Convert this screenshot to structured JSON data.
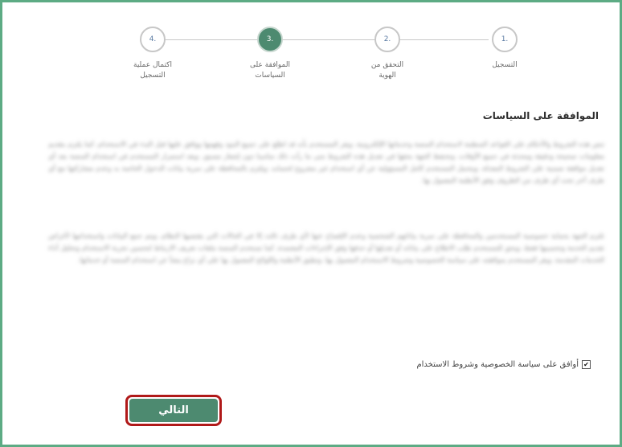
{
  "steps": [
    {
      "number": "1.",
      "label": "التسجيل"
    },
    {
      "number": "2.",
      "label": "التحقق من الهوية"
    },
    {
      "number": "3.",
      "label": "الموافقة على السياسات"
    },
    {
      "number": "4.",
      "label": "اكتمال عملية التسجيل"
    }
  ],
  "active_step": 3,
  "section_title": "الموافقة على السياسات",
  "policy_paragraphs": [
    "تنص هذه الشروط والأحكام على القواعد المنظمة لاستخدام المنصة وخدماتها الإلكترونية، ويقر المستخدم بأنه قد اطلع على جميع البنود وفهمها ووافق عليها قبل البدء في الاستخدام، كما يلتزم بتقديم معلومات صحيحة ودقيقة ومحدثة في جميع الأوقات، وتحتفظ الجهة بحقها في تعديل هذه الشروط متى ما رأت ذلك مناسبا دون إشعار مسبق، ويعد استمرار المستخدم في استخدام المنصة بعد أي تعديل موافقة ضمنية على الشروط المعدلة، ويتحمل المستخدم كامل المسؤولية عن أي استخدام غير مشروع لحسابه، ويلتزم بالمحافظة على سرية بيانات الدخول الخاصة به وعدم مشاركتها مع أي طرف آخر تحت أي ظرف من الظروف وفق الأنظمة المعمول بها.",
    "تلتزم الجهة بحماية خصوصية المستخدمين والمحافظة على سرية بياناتهم الشخصية وعدم الإفصاح عنها لأي طرف ثالث إلا في الحالات التي يقتضيها النظام، ويتم جمع البيانات واستخدامها لأغراض تقديم الخدمة وتحسينها فقط، ويحق للمستخدم طلب الاطلاع على بياناته أو تعديلها أو حذفها وفق الإجراءات المعتمدة، كما تستخدم المنصة ملفات تعريف الارتباط لتحسين تجربة الاستخدام وتحليل أداء الخدمات المقدمة، ويقر المستخدم بموافقته على سياسة الخصوصية وشروط الاستخدام المعمول بها، وتطبق الأنظمة واللوائح المعمول بها على أي نزاع ينشأ عن استخدام المنصة أو خدماتها."
  ],
  "consent": {
    "checked": true,
    "label": "أوافق على سياسة الخصوصية وشروط الاستخدام"
  },
  "next_button": "التالي",
  "colors": {
    "accent": "#4d8a70",
    "frame": "#5dab84",
    "highlight": "#b01919"
  }
}
